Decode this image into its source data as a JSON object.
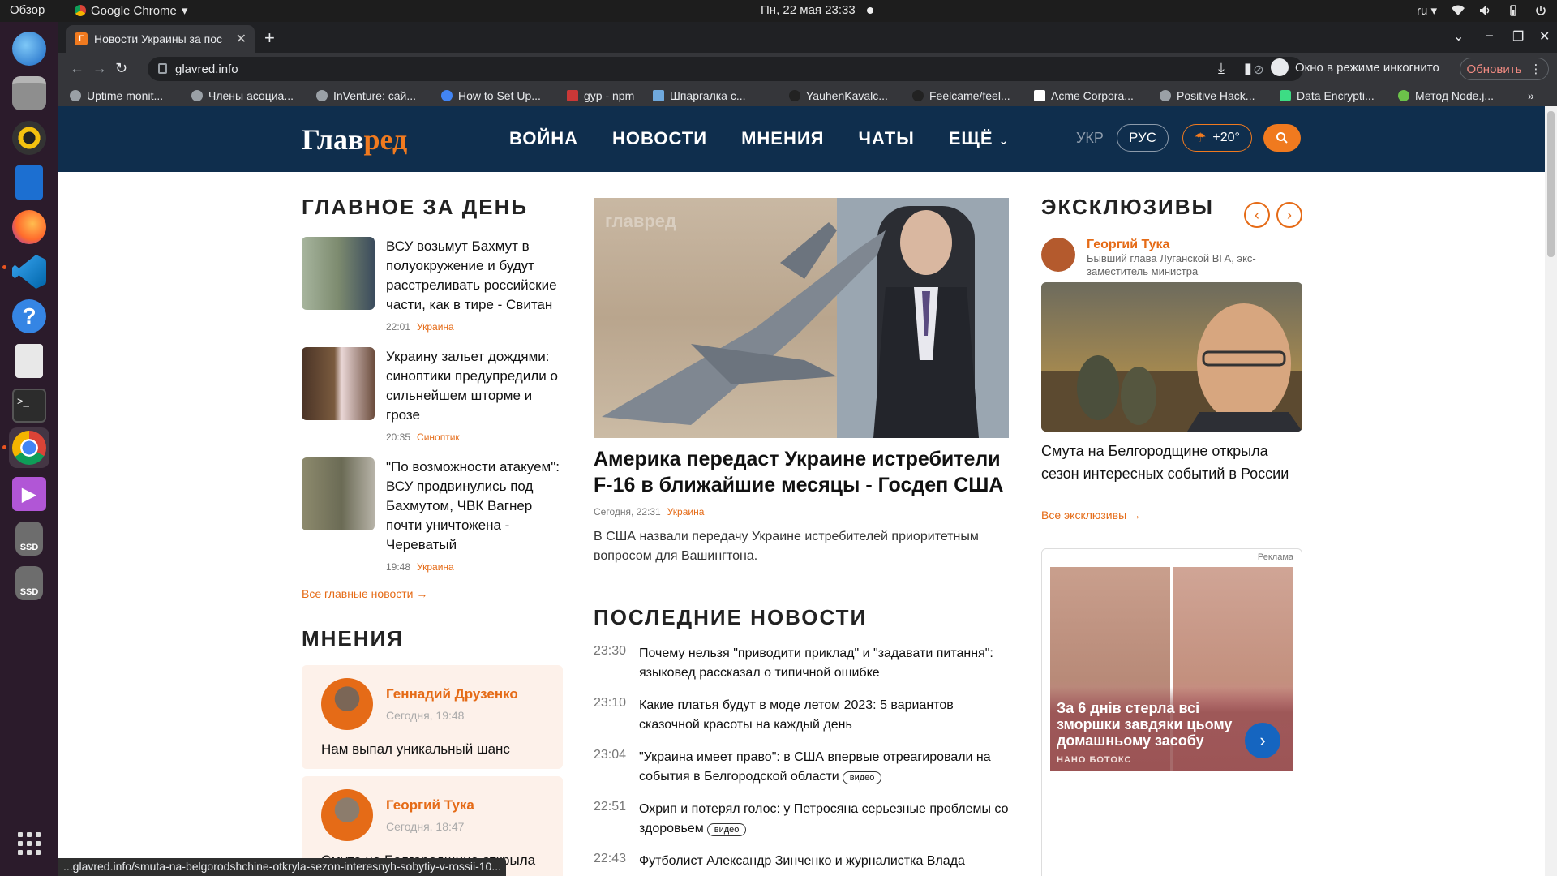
{
  "topbar": {
    "activities": "Обзор",
    "app_name": "Google Chrome",
    "datetime": "Пн, 22 мая  23:33",
    "lang": "ru"
  },
  "dock": {
    "items": [
      "thunderbird-icon",
      "files-icon",
      "rhythmbox-icon",
      "writer-icon",
      "firefox-icon",
      "vscode-icon",
      "help-icon",
      "reader-icon",
      "terminal-icon",
      "chrome-icon",
      "media-player-icon",
      "ssd-drive-icon",
      "ssd-drive-icon",
      "show-apps-icon"
    ],
    "ssd_label": "SSD"
  },
  "browser": {
    "tab_title": "Новости Украины за пос",
    "tab_favicon": "Г",
    "url": "glavred.info",
    "incognito_label": "Окно в режиме инкогнито",
    "update_label": "Обновить",
    "bookmarks": [
      "Uptime monit...",
      "Члены асоциа...",
      "InVenture: сай...",
      "How to Set Up...",
      "gyp - npm",
      "Шпаргалка с...",
      "YauhenKavalc...",
      "Feelcame/feel...",
      "Acme Corpora...",
      "Positive Hack...",
      "Data Encrypti...",
      "Метод Node.j..."
    ]
  },
  "site": {
    "logo_left": "Глав",
    "logo_right": "ред",
    "nav": [
      "ВОЙНА",
      "НОВОСТИ",
      "МНЕНИЯ",
      "ЧАТЫ",
      "ЕЩЁ"
    ],
    "lang_ukr": "УКР",
    "lang_rus": "РУС",
    "weather": "+20°"
  },
  "top_day": {
    "heading": "ГЛАВНОЕ ЗА ДЕНЬ",
    "items": [
      {
        "title": "ВСУ возьмут Бахмут в полуокружение и будут расстреливать российские части, как в тире - Свитан",
        "time": "22:01",
        "tag": "Украина"
      },
      {
        "title": "Украину зальет дождями: синоптики предупредили о сильнейшем шторме и грозе",
        "time": "20:35",
        "tag": "Синоптик"
      },
      {
        "title": "\"По возможности атакуем\": ВСУ продвинулись под Бахмутом, ЧВК Вагнер почти уничтожена - Череватый",
        "time": "19:48",
        "tag": "Украина"
      }
    ],
    "all_link": "Все главные новости →"
  },
  "opinions": {
    "heading": "МНЕНИЯ",
    "items": [
      {
        "name": "Геннадий Друзенко",
        "date": "Сегодня, 19:48",
        "text": "Нам выпал уникальный шанс"
      },
      {
        "name": "Георгий Тука",
        "date": "Сегодня, 18:47",
        "text": "Смута на Белгородщине открыла"
      }
    ]
  },
  "hero": {
    "title": "Америка передаст Украине истребители F-16 в ближайшие месяцы - Госдеп США",
    "date": "Сегодня, 22:31",
    "tag": "Украина",
    "lead": "В США назвали передачу Украине истребителей приоритетным вопросом для Вашингтона.",
    "watermark": "главред"
  },
  "latest": {
    "heading": "ПОСЛЕДНИЕ НОВОСТИ",
    "video_label": "видео",
    "items": [
      {
        "time": "23:30",
        "title": "Почему нельзя \"приводити приклад\" и \"задавати питання\": языковед рассказал о типичной ошибке"
      },
      {
        "time": "23:10",
        "title": "Какие платья будут в моде летом 2023: 5 вариантов сказочной красоты на каждый день"
      },
      {
        "time": "23:04",
        "title": "\"Украина имеет право\": в США впервые отреагировали на события в Белгородской области"
      },
      {
        "time": "22:51",
        "title": "Охрип и потерял голос: у Петросяна серьезные проблемы со здоровьем"
      },
      {
        "time": "22:43",
        "title": "Футболист Александр Зинченко и журналистка Влада"
      }
    ]
  },
  "exclusives": {
    "heading": "ЭКСКЛЮЗИВЫ",
    "author": "Георгий Тука",
    "author_desc": "Бывший глава Луганской ВГА, экс-заместитель министра",
    "title": "Смута на Белгородщине открыла сезон интересных событий в России",
    "all_link": "Все эксклюзивы →"
  },
  "ad": {
    "label": "Реклама",
    "headline": "За 6 днів стерла всі зморшки завдяки цьому домашньому засобу",
    "sponsor": "НАНО БОТОКС"
  },
  "status_url": "...glavred.info/smuta-na-belgorodshchine-otkryla-sezon-interesnyh-sobytiy-v-rossii-10..."
}
